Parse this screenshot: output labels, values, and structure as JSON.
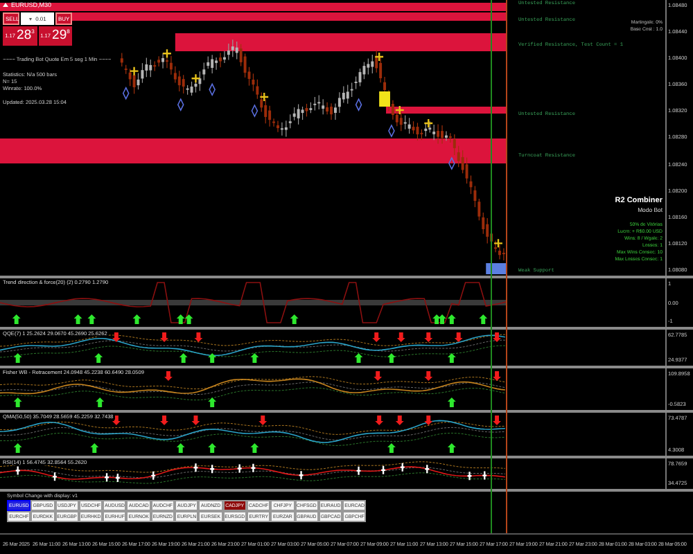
{
  "chart": {
    "title": "EURUSD,M30"
  },
  "trade_panel": {
    "sell_label": "SELL",
    "lot": "0.01",
    "buy_label": "BUY",
    "sell_price": {
      "prefix": "1.17",
      "big": "28",
      "small": "3"
    },
    "buy_price": {
      "prefix": "1.17",
      "big": "29",
      "small": "8"
    }
  },
  "info_left": [
    "~~~~ Trading Bot Quote Em 5 seg 1 Min ~~~~",
    "Statistics: N/a 500 bars",
    "N= 15",
    "Winrate: 100.0%",
    "Updated: 2025.03.28 15:04"
  ],
  "info_right": [
    {
      "text": "Martingale: 0%",
      "kind": "small"
    },
    {
      "text": "Base Cost : 1.0",
      "kind": "small"
    },
    {
      "text": "R2 Combiner",
      "kind": "title"
    },
    {
      "text": "Modo Bot",
      "kind": "subtitle"
    },
    {
      "text": "50% de Vitórias",
      "kind": "green"
    },
    {
      "text": "Lucro: + R$0.00 USD",
      "kind": "green"
    },
    {
      "text": "Wins: 8 / Wgale: 2",
      "kind": "green"
    },
    {
      "text": "Losses: 1",
      "kind": "green"
    },
    {
      "text": "Max Wins Consec: 10",
      "kind": "green"
    },
    {
      "text": "Max Losses Consec: 1",
      "kind": "green"
    }
  ],
  "zones": [
    {
      "label": "Untested Resistance",
      "kind": "resistance"
    },
    {
      "label": "Untested Resistance",
      "kind": "resistance"
    },
    {
      "label": "Verified Resistance, Test Count = 1",
      "kind": "resistance"
    },
    {
      "label": "Untested Resistance",
      "kind": "resistance"
    },
    {
      "label": "Turncoat Resistance",
      "kind": "resistance"
    },
    {
      "label": "Weak Support",
      "kind": "support"
    }
  ],
  "price_axis": [
    "1.08480",
    "1.08440",
    "1.08400",
    "1.08360",
    "1.08320",
    "1.08280",
    "1.08240",
    "1.08200",
    "1.08160",
    "1.08120",
    "1.08080"
  ],
  "indicators": [
    {
      "kind": "trend",
      "title": "Trend direction & force(20) (2) 0.2790 1.2790",
      "axis_labels": [
        "1",
        "0.00",
        "-1"
      ]
    },
    {
      "kind": "bands_blue",
      "title": "QQE(7) 1 25.2624 29.0670 45.2690 25.6262",
      "axis_labels": [
        "62.7785",
        "24.9377"
      ]
    },
    {
      "kind": "bands_orange",
      "title": "Fisher WB - Retracement 24.0948 45.2238 60.6490 28.0509",
      "axis_labels": [
        "109.8958",
        "-0.5823"
      ]
    },
    {
      "kind": "bands_blue",
      "title": "QMA(50,50) 35.7049 28.5659 45.2259 32.7438",
      "axis_labels": [
        "73.4787",
        "4.3008"
      ]
    },
    {
      "kind": "rsi",
      "title": "RSI(14) 1 56.4745 32.8564 55.2620",
      "axis_labels": [
        "78.7659",
        "34.4725"
      ]
    }
  ],
  "symbol_panel": {
    "title": "Symbol Change with display: v1",
    "rows": [
      [
        {
          "symbol": "EURUSD",
          "selected": true,
          "highlighted": false
        },
        {
          "symbol": "GBPUSD",
          "selected": false,
          "highlighted": false
        },
        {
          "symbol": "USDJPY",
          "selected": false,
          "highlighted": false
        },
        {
          "symbol": "USDCHF",
          "selected": false,
          "highlighted": false
        },
        {
          "symbol": "AUDUSD",
          "selected": false,
          "highlighted": false
        },
        {
          "symbol": "AUDCAD",
          "selected": false,
          "highlighted": false
        },
        {
          "symbol": "AUDCHF",
          "selected": false,
          "highlighted": false
        },
        {
          "symbol": "AUDJPY",
          "selected": false,
          "highlighted": false
        },
        {
          "symbol": "AUDNZD",
          "selected": false,
          "highlighted": false
        },
        {
          "symbol": "CADJPY",
          "selected": false,
          "highlighted": true
        },
        {
          "symbol": "CADCHF",
          "selected": false,
          "highlighted": false
        },
        {
          "symbol": "CHFJPY",
          "selected": false,
          "highlighted": false
        },
        {
          "symbol": "CHFSGD",
          "selected": false,
          "highlighted": false
        },
        {
          "symbol": "EURAUD",
          "selected": false,
          "highlighted": false
        },
        {
          "symbol": "EURCAD",
          "selected": false,
          "highlighted": false
        }
      ],
      [
        {
          "symbol": "EURCHF",
          "selected": false,
          "highlighted": false
        },
        {
          "symbol": "EURDKK",
          "selected": false,
          "highlighted": false
        },
        {
          "symbol": "EURGBP",
          "selected": false,
          "highlighted": false
        },
        {
          "symbol": "EURHKD",
          "selected": false,
          "highlighted": false
        },
        {
          "symbol": "EURHUF",
          "selected": false,
          "highlighted": false
        },
        {
          "symbol": "EURNOK",
          "selected": false,
          "highlighted": false
        },
        {
          "symbol": "EURNZD",
          "selected": false,
          "highlighted": false
        },
        {
          "symbol": "EURPLN",
          "selected": false,
          "highlighted": false
        },
        {
          "symbol": "EURSEK",
          "selected": false,
          "highlighted": false
        },
        {
          "symbol": "EURSGD",
          "selected": false,
          "highlighted": false
        },
        {
          "symbol": "EURTRY",
          "selected": false,
          "highlighted": false
        },
        {
          "symbol": "EURZAR",
          "selected": false,
          "highlighted": false
        },
        {
          "symbol": "GBPAUD",
          "selected": false,
          "highlighted": false
        },
        {
          "symbol": "GBPCAD",
          "selected": false,
          "highlighted": false
        },
        {
          "symbol": "GBPCHF",
          "selected": false,
          "highlighted": false
        }
      ]
    ]
  },
  "time_axis": [
    "26 Mar 2025",
    "26 Mar 11:00",
    "26 Mar 13:00",
    "26 Mar 15:00",
    "26 Mar 17:00",
    "26 Mar 19:00",
    "26 Mar 21:00",
    "26 Mar 23:00",
    "27 Mar 01:00",
    "27 Mar 03:00",
    "27 Mar 05:00",
    "27 Mar 07:00",
    "27 Mar 09:00",
    "27 Mar 11:00",
    "27 Mar 13:00",
    "27 Mar 15:00",
    "27 Mar 17:00",
    "27 Mar 19:00",
    "27 Mar 21:00",
    "27 Mar 23:00",
    "28 Mar 01:00",
    "28 Mar 03:00",
    "28 Mar 05:00"
  ]
}
